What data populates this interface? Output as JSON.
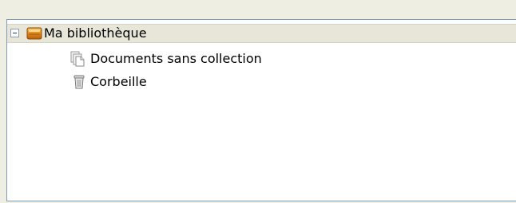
{
  "tree": {
    "root": {
      "label": "Ma bibliothèque",
      "icon": "library-icon",
      "expanded": true
    },
    "children": [
      {
        "label": "Documents sans collection",
        "icon": "documents-icon"
      },
      {
        "label": "Corbeille",
        "icon": "trash-icon"
      }
    ]
  },
  "colors": {
    "window_bg": "#efeee3",
    "panel_bg": "#ffffff",
    "selected_row_bg": "#e7e6d9",
    "border": "#7f9db9"
  }
}
